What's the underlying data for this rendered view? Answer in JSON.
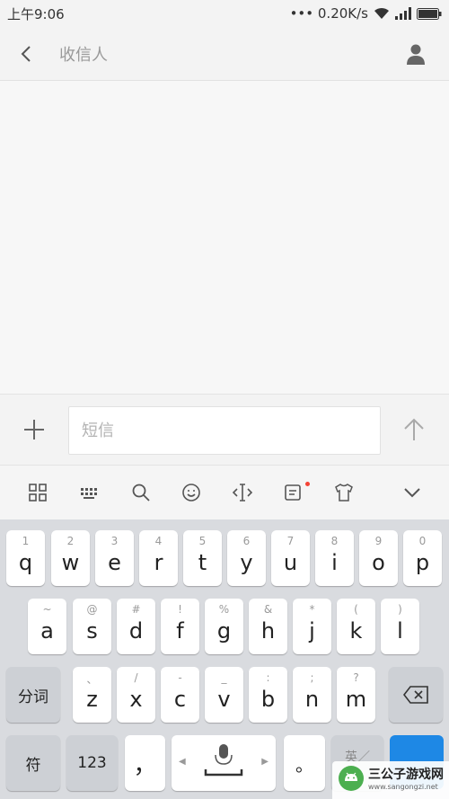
{
  "status": {
    "time": "上午9:06",
    "network": "••• 0.20K/s"
  },
  "header": {
    "title": "收信人"
  },
  "composer": {
    "placeholder": "短信"
  },
  "keyboard": {
    "row1": [
      {
        "hint": "1",
        "key": "q"
      },
      {
        "hint": "2",
        "key": "w"
      },
      {
        "hint": "3",
        "key": "e"
      },
      {
        "hint": "4",
        "key": "r"
      },
      {
        "hint": "5",
        "key": "t"
      },
      {
        "hint": "6",
        "key": "y"
      },
      {
        "hint": "7",
        "key": "u"
      },
      {
        "hint": "8",
        "key": "i"
      },
      {
        "hint": "9",
        "key": "o"
      },
      {
        "hint": "0",
        "key": "p"
      }
    ],
    "row2": [
      {
        "hint": "~",
        "key": "a"
      },
      {
        "hint": "@",
        "key": "s"
      },
      {
        "hint": "#",
        "key": "d"
      },
      {
        "hint": "!",
        "key": "f"
      },
      {
        "hint": "%",
        "key": "g"
      },
      {
        "hint": "&",
        "key": "h"
      },
      {
        "hint": "*",
        "key": "j"
      },
      {
        "hint": "(",
        "key": "k"
      },
      {
        "hint": ")",
        "key": "l"
      }
    ],
    "row3": [
      {
        "hint": "、",
        "key": "z"
      },
      {
        "hint": "/",
        "key": "x"
      },
      {
        "hint": "-",
        "key": "c"
      },
      {
        "hint": "_",
        "key": "v"
      },
      {
        "hint": ":",
        "key": "b"
      },
      {
        "hint": ";",
        "key": "n"
      },
      {
        "hint": "?",
        "key": "m"
      }
    ],
    "fenci": "分词",
    "symbols": "符",
    "numbers": "123",
    "comma": "，",
    "period": "。",
    "lang": "英／"
  },
  "watermark": {
    "title": "三公子游戏网",
    "url": "www.sangongzi.net"
  },
  "colors": {
    "accent": "#1e88e5",
    "notification_dot": "#f44336"
  }
}
